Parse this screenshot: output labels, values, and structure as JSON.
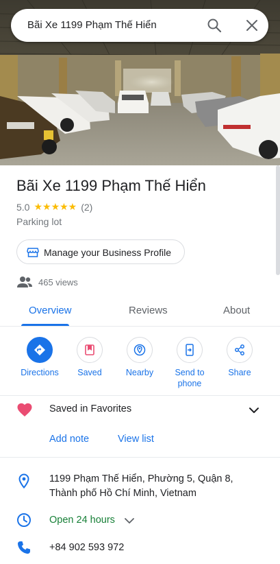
{
  "search": {
    "query": "Bãi Xe 1199 Phạm Thế Hiển"
  },
  "place": {
    "title": "Bãi Xe 1199 Phạm Thế Hiển",
    "rating": "5.0",
    "stars": "★★★★★",
    "review_count": "(2)",
    "category": "Parking lot"
  },
  "manage_button": {
    "label": "Manage your Business Profile"
  },
  "views": {
    "text": "465 views"
  },
  "tabs": [
    {
      "label": "Overview",
      "active": true
    },
    {
      "label": "Reviews"
    },
    {
      "label": "About"
    }
  ],
  "actions": [
    {
      "label": "Directions",
      "icon": "directions-icon"
    },
    {
      "label": "Saved",
      "icon": "bookmark-icon"
    },
    {
      "label": "Nearby",
      "icon": "nearby-icon"
    },
    {
      "label": "Send to phone",
      "icon": "send-to-phone-icon"
    },
    {
      "label": "Share",
      "icon": "share-icon"
    }
  ],
  "saved": {
    "list_name": "Saved in Favorites",
    "add_note": "Add note",
    "view_list": "View list"
  },
  "info": {
    "address": "1199 Phạm Thế Hiển, Phường 5, Quận 8, Thành phố Hồ Chí Minh, Vietnam",
    "hours": "Open 24 hours",
    "phone": "+84 902 593 972"
  },
  "colors": {
    "accent": "#1a73e8",
    "star": "#fbbc04",
    "open": "#188038",
    "heart": "#ea4c72"
  }
}
